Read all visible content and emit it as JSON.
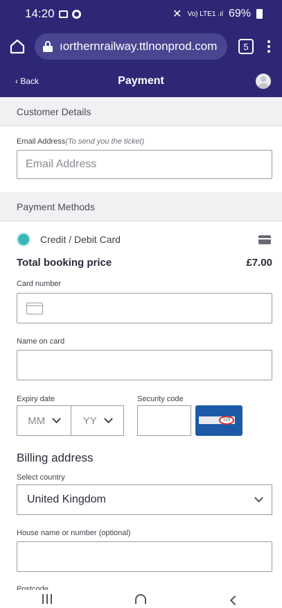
{
  "status_bar": {
    "time": "14:20",
    "network": "Vo) LTE1 .ıl",
    "battery": "69%"
  },
  "browser": {
    "url": "ıorthernrailway.ttlnonprod.com",
    "tab_count": "5"
  },
  "header": {
    "back_label": "‹ Back",
    "title": "Payment"
  },
  "customer_details": {
    "section_title": "Customer Details",
    "email_label": "Email Address",
    "email_hint": "(To send you the ticket)",
    "email_placeholder": "Email Address"
  },
  "payment_methods": {
    "section_title": "Payment Methods",
    "selected_method": "Credit / Debit Card",
    "total_label": "Total booking price",
    "total_value": "£7.00",
    "card_number_label": "Card number",
    "name_on_card_label": "Name on card",
    "expiry_label": "Expiry date",
    "expiry_month_placeholder": "MM",
    "expiry_year_placeholder": "YY",
    "security_code_label": "Security code",
    "cvv_example": "123"
  },
  "billing": {
    "title": "Billing address",
    "country_label": "Select country",
    "country_value": "United Kingdom",
    "house_label": "House name or number (optional)",
    "postcode_label": "Postcode"
  },
  "colors": {
    "brand": "#2d2775",
    "accent": "#3ab6b5",
    "card_blue": "#1c5aa8"
  }
}
